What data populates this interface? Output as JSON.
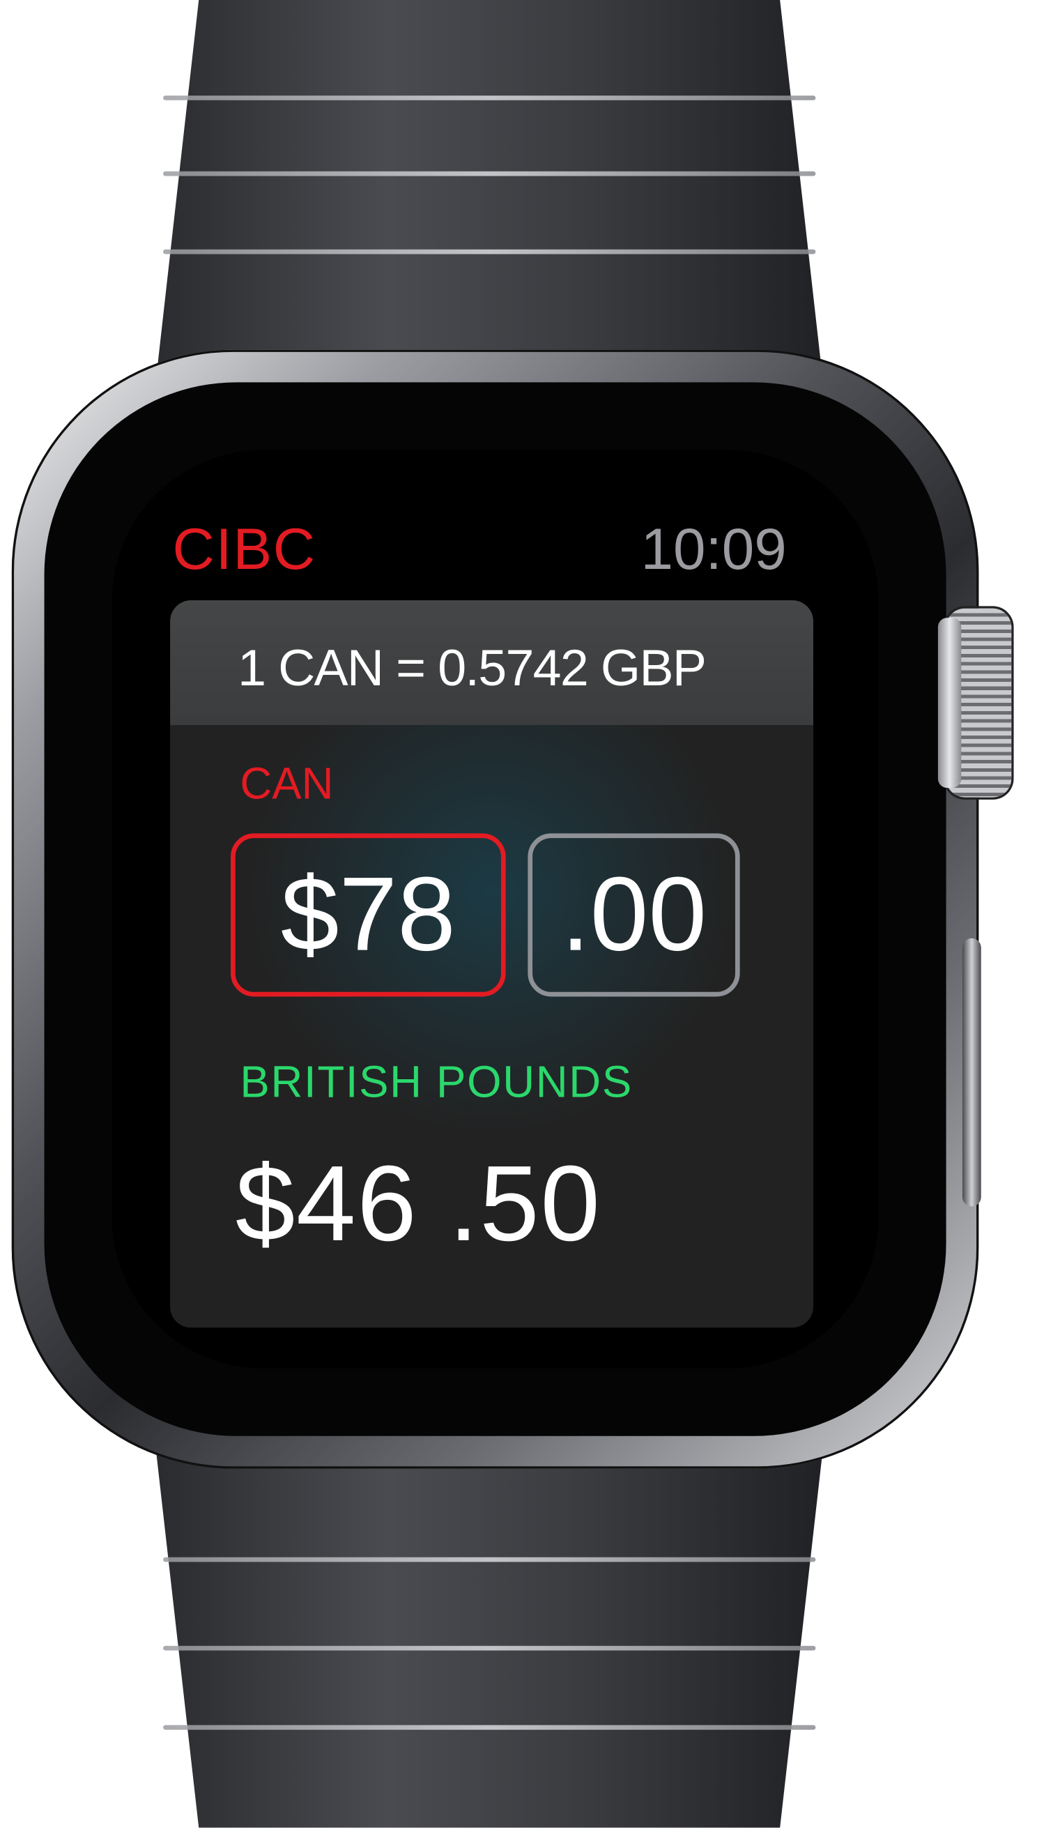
{
  "app": {
    "name": "CIBC"
  },
  "status": {
    "time": "10:09"
  },
  "converter": {
    "rate_text": "1 CAN =  0.5742 GBP",
    "from_currency": "CAN",
    "amount_whole": "$78",
    "amount_cents": ".00",
    "to_currency": "BRITISH  POUNDS",
    "converted_amount": "$46 .50"
  },
  "colors": {
    "brand": "#e31b23",
    "target_currency": "#2bd86b",
    "clock": "#9b9ba0"
  },
  "icons": [
    "digital-crown",
    "side-button"
  ]
}
